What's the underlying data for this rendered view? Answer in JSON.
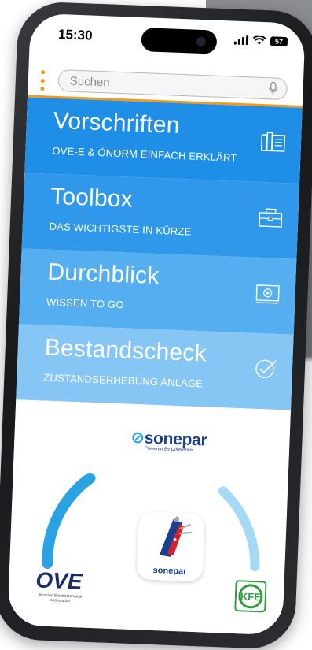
{
  "status": {
    "time": "15:30",
    "battery": "57"
  },
  "search": {
    "placeholder": "Suchen"
  },
  "tiles": [
    {
      "title": "Vorschriften",
      "subtitle": "OVE-E & ÖNORM EINFACH ERKLÄRT",
      "icon": "books-icon"
    },
    {
      "title": "Toolbox",
      "subtitle": "DAS WICHTIGSTE IN KÜRZE",
      "icon": "toolbox-icon"
    },
    {
      "title": "Durchblick",
      "subtitle": "WISSEN TO GO",
      "icon": "video-icon"
    },
    {
      "title": "Bestandscheck",
      "subtitle": "ZUSTANDSERHEBUNG ANLAGE",
      "icon": "checkmark-icon"
    }
  ],
  "partners": {
    "sonepar_logo": "sonepar",
    "sonepar_tagline": "Powered By Difference",
    "app_icon_label": "sonepar",
    "ove_logo": "OVE",
    "ove_sub": "Austrian Electrotechnical Association",
    "kfe_logo": "KFE"
  },
  "colors": {
    "accent": "#f39a1e",
    "tile1": "#1e8ee6",
    "tile2": "#2f98ea",
    "tile3": "#55aef0",
    "tile4": "#86c6f5",
    "sonepar_blue": "#1b3f8f",
    "kfe_green": "#2e9e3e"
  }
}
